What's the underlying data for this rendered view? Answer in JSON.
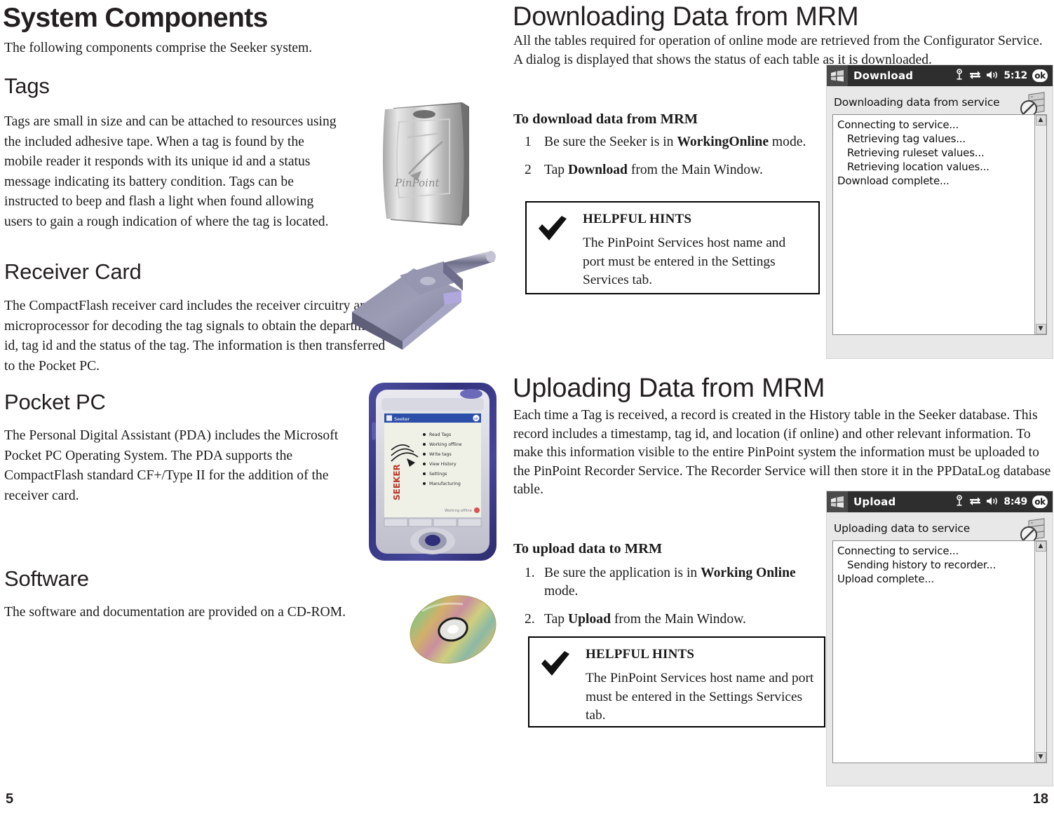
{
  "left_page": {
    "page_number": "5",
    "title": "System Components",
    "intro": "The following components comprise the Seeker system.",
    "sections": [
      {
        "heading": "Tags",
        "body": "Tags are small in size and can be attached to resources using the included adhesive tape.  When a tag is found by the mobile reader it responds with its unique id and a status message indicating its battery condition.  Tags can be instructed to beep and flash a light when found allowing users to gain a rough indication of where the tag is located.",
        "image": "pinpoint-tag-photo"
      },
      {
        "heading": "Receiver Card",
        "body": "The CompactFlash receiver card includes the receiver circuitry and the microprocessor for decoding the tag signals to obtain the department id, tag id and the status of the tag. The information is then transferred to the Pocket PC.",
        "image": "compactflash-receiver-card-photo"
      },
      {
        "heading": "Pocket PC",
        "body": "The Personal Digital Assistant (PDA) includes the Microsoft Pocket PC Operating System. The PDA supports the CompactFlash standard CF+/Type II for the addition of the receiver card.",
        "image": "pocket-pc-pda-photo"
      },
      {
        "heading": "Software",
        "body": "The software and documentation are provided on a CD-ROM.",
        "image": "cd-rom-photo"
      }
    ],
    "pda_photo_screen": {
      "title": "Seeker",
      "logo_text": "SEEKER",
      "menu_items": [
        "Read Tags",
        "Working offline",
        "Write tags",
        "View History",
        "Settings",
        "Manufacturing"
      ],
      "footer": "Working offline"
    }
  },
  "right_page": {
    "page_number": "18",
    "download": {
      "title": "Downloading Data from MRM",
      "intro": "All the tables required for operation of online mode are retrieved from the Configurator Service.  A dialog is displayed that shows the status of each table as it is downloaded.",
      "procedure_heading": "To download data from MRM",
      "steps": [
        {
          "num": "1",
          "text_before": "Be sure the Seeker is in ",
          "bold": "WorkingOnline",
          "text_after": " mode."
        },
        {
          "num": "2",
          "text_before": "Tap ",
          "bold": "Download",
          "text_after": " from the Main Window."
        }
      ],
      "hints": {
        "title": "HELPFUL HINTS",
        "text": "The PinPoint Services host name and port must be entered in the Settings Services tab.",
        "icon": "checkmark-icon"
      },
      "screenshot": {
        "window_title": "Download",
        "time": "5:12",
        "ok_label": "ok",
        "caption": "Downloading data from service",
        "log_lines": [
          {
            "text": "Connecting to service...",
            "indent": false
          },
          {
            "text": "Retrieving tag values...",
            "indent": true
          },
          {
            "text": "Retrieving ruleset values...",
            "indent": true
          },
          {
            "text": "Retrieving location values...",
            "indent": true
          },
          {
            "text": "Download complete...",
            "indent": false
          }
        ],
        "status_icons": [
          "antenna-icon",
          "sync-icon",
          "speaker-icon"
        ]
      }
    },
    "upload": {
      "title": "Uploading Data from MRM",
      "intro": "Each time a Tag is received,  a record is created in the History table in the Seeker database. This record includes a timestamp, tag id, and location (if online) and other relevant information.  To make this information visible to the entire PinPoint system the information must be uploaded to the PinPoint Recorder Service.  The Recorder Service will then store it in the PPDataLog database table.",
      "procedure_heading": "To upload data to MRM",
      "steps": [
        {
          "num": "1.",
          "text_before": "Be sure the application is in ",
          "bold": "Working Online",
          "text_after": " mode."
        },
        {
          "num": "2.",
          "text_before": "Tap ",
          "bold": "Upload",
          "text_after": " from the Main Window."
        }
      ],
      "hints": {
        "title": "HELPFUL HINTS",
        "text": "The PinPoint Services host name and port must be entered in the Settings Services tab.",
        "icon": "checkmark-icon"
      },
      "screenshot": {
        "window_title": "Upload",
        "time": "8:49",
        "ok_label": "ok",
        "caption": "Uploading data to service",
        "log_lines": [
          {
            "text": "Connecting to service...",
            "indent": false
          },
          {
            "text": "Sending history to recorder...",
            "indent": true
          },
          {
            "text": "Upload complete...",
            "indent": false
          }
        ],
        "status_icons": [
          "antenna-icon",
          "sync-icon",
          "speaker-icon"
        ]
      }
    }
  },
  "colors": {
    "text": "#1a1a1a",
    "heading": "#231f20",
    "titlebar": "#2e2e2e",
    "pda_body": "#3a3a8c",
    "tag_silver": "#b9b9b9",
    "card_purple": "#8d8daf"
  }
}
